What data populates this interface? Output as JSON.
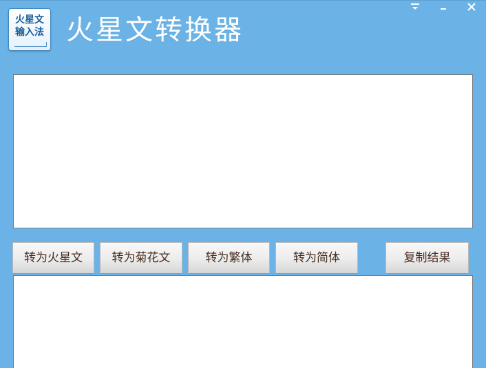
{
  "logo": {
    "line1": "火星文",
    "line2": "输入法"
  },
  "app": {
    "title": "火星文转换器"
  },
  "window_controls": {
    "menu_icon": "dropdown-menu-icon",
    "minimize_icon": "minimize-icon",
    "close_icon": "close-icon",
    "color": "#ffffff"
  },
  "input": {
    "value": ""
  },
  "buttons": {
    "to_huoxing": "转为火星文",
    "to_juhua": "转为菊花文",
    "to_fanti": "转为繁体",
    "to_jianti": "转为简体",
    "copy_result": "复制结果"
  },
  "output": {
    "value": ""
  },
  "colors": {
    "background": "#6bb3e6",
    "button_text": "#4a2e20",
    "logo_text": "#1d5f99"
  }
}
